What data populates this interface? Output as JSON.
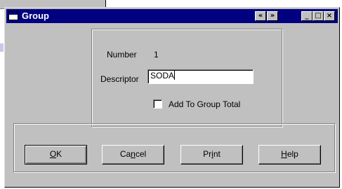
{
  "window": {
    "title": "Group",
    "prev_glyph": "«",
    "next_glyph": "»",
    "minimize_glyph": "_",
    "maximize_glyph": "□",
    "close_glyph": "×"
  },
  "form": {
    "number_label": "Number",
    "number_value": "1",
    "descriptor_label": "Descriptor",
    "descriptor_value": "SODA",
    "add_to_group_label": "Add To Group Total",
    "add_to_group_checked": false
  },
  "buttons": {
    "ok": {
      "underline": "O",
      "rest": "K"
    },
    "cancel": {
      "before": "Ca",
      "underline": "n",
      "rest": "cel"
    },
    "print": {
      "before": "Pr",
      "underline": "i",
      "rest": "nt"
    },
    "help": {
      "underline": "H",
      "rest": "elp"
    }
  },
  "colors": {
    "titlebar": "#000080",
    "face": "#c0c0c0"
  }
}
